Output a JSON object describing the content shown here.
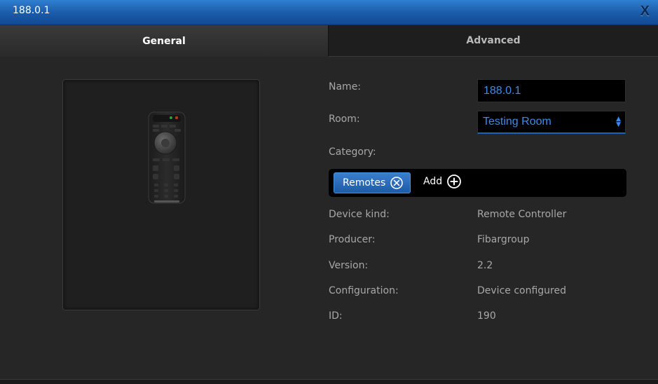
{
  "window": {
    "title": "188.0.1",
    "close_label": "X"
  },
  "tabs": [
    {
      "label": "General",
      "active": true
    },
    {
      "label": "Advanced",
      "active": false
    }
  ],
  "form": {
    "name_label": "Name:",
    "name_value": "188.0.1",
    "room_label": "Room:",
    "room_value": "Testing Room",
    "category_label": "Category:",
    "category_chip": "Remotes",
    "category_add": "Add"
  },
  "info": {
    "device_kind_label": "Device kind:",
    "device_kind_value": "Remote Controller",
    "producer_label": "Producer:",
    "producer_value": "Fibargroup",
    "version_label": "Version:",
    "version_value": "2.2",
    "configuration_label": "Configuration:",
    "configuration_value": "Device configured",
    "id_label": "ID:",
    "id_value": "190"
  },
  "colors": {
    "titlebar": "#1a5aa8",
    "accent_text": "#3c8cf0",
    "background": "#262626",
    "label_text": "#a8a8a8"
  },
  "icons": {
    "close": "close-icon",
    "chip_remove": "circle-x-icon",
    "add": "circle-plus-icon",
    "select": "updown-arrows-icon",
    "device": "remote-control-icon"
  }
}
